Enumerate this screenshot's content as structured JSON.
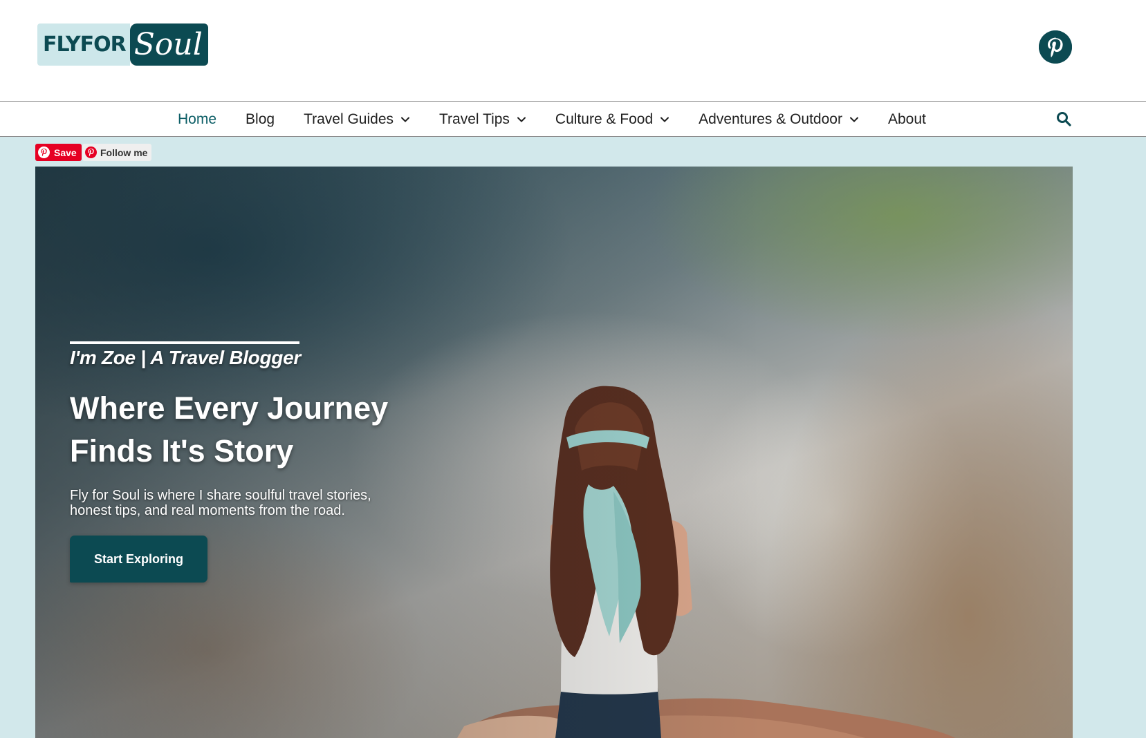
{
  "header": {
    "logo": {
      "part1": "FLYFOR",
      "part2": "Soul"
    },
    "social": {
      "icon": "pinterest-icon"
    }
  },
  "nav": {
    "items": [
      {
        "label": "Home",
        "active": true,
        "dropdown": false
      },
      {
        "label": "Blog",
        "active": false,
        "dropdown": false
      },
      {
        "label": "Travel Guides",
        "active": false,
        "dropdown": true
      },
      {
        "label": "Travel Tips",
        "active": false,
        "dropdown": true
      },
      {
        "label": "Culture & Food",
        "active": false,
        "dropdown": true
      },
      {
        "label": "Adventures & Outdoor",
        "active": false,
        "dropdown": true
      },
      {
        "label": "About",
        "active": false,
        "dropdown": false
      }
    ],
    "search_icon": "search-icon"
  },
  "pinterest_widgets": {
    "save_label": "Save",
    "follow_label": "Follow me"
  },
  "hero": {
    "tagline": "I'm Zoe | A Travel Blogger",
    "headline_line1": "Where Every Journey",
    "headline_line2": "Finds It's Story",
    "intro_line1": "Fly for Soul is where I share soulful travel stories,",
    "intro_line2": "honest tips, and real moments from the road.",
    "cta_label": "Start Exploring"
  },
  "colors": {
    "brand_dark": "#0c4a52",
    "brand_light": "#cde7ea",
    "band_bg": "#d2e8eb",
    "pinterest_red": "#e60023",
    "nav_active": "#0c5e66"
  }
}
